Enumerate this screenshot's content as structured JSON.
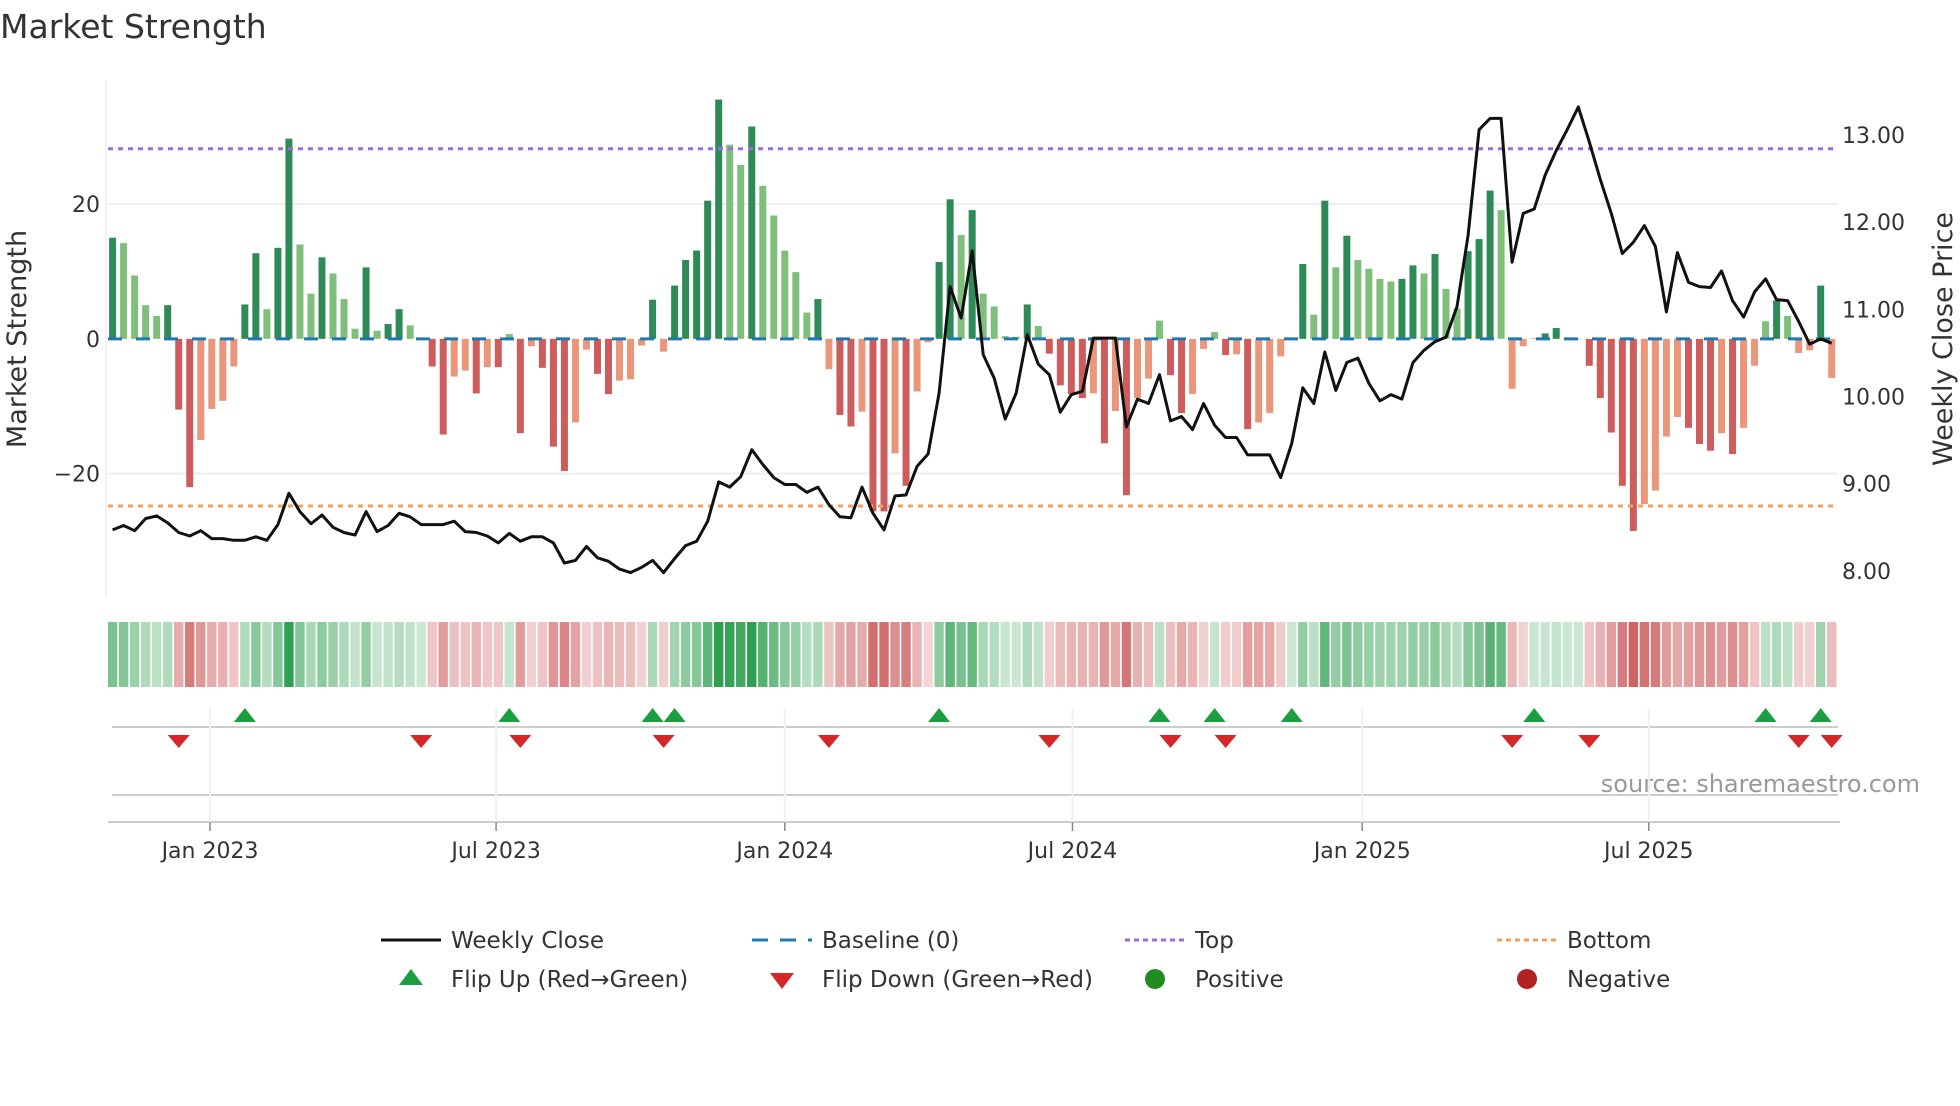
{
  "title": "Market Strength",
  "source": "source: sharemaestro.com",
  "colors": {
    "strong_pos": "#2e8b57",
    "weak_pos": "#7fbf7b",
    "strong_neg": "#cd5c5c",
    "weak_neg": "#e9967a",
    "price": "#111111",
    "baseline": "#1f77b4",
    "top": "#9b6be0",
    "bottom": "#f0a060",
    "flip_up": "#1a9e3f",
    "flip_down": "#d62728",
    "positive": "#228b22",
    "negative": "#b22222"
  },
  "chart_data": {
    "type": "bar",
    "title": "Market Strength",
    "ylabel": "Market Strength",
    "y2label": "Weekly Close Price",
    "ylim": [
      -38.3,
      38.4
    ],
    "y2lim": [
      7.7,
      13.63
    ],
    "yticks": [
      {
        "v": 20,
        "label": "20"
      },
      {
        "v": 0,
        "label": "0"
      },
      {
        "v": -20,
        "label": "−20"
      }
    ],
    "y2ticks": [
      {
        "v": 13,
        "label": "13.00"
      },
      {
        "v": 12,
        "label": "12.00"
      },
      {
        "v": 11,
        "label": "11.00"
      },
      {
        "v": 10,
        "label": "10.00"
      },
      {
        "v": 9,
        "label": "9.00"
      },
      {
        "v": 8,
        "label": "8.00"
      }
    ],
    "xticks": [
      {
        "i": 8.84,
        "label": "Jan 2023"
      },
      {
        "i": 34.8,
        "label": "Jul 2023"
      },
      {
        "i": 61.0,
        "label": "Jan 2024"
      },
      {
        "i": 87.1,
        "label": "Jul 2024"
      },
      {
        "i": 113.4,
        "label": "Jan 2025"
      },
      {
        "i": 139.4,
        "label": "Jul 2025"
      }
    ],
    "top": 28.2,
    "bottom": -24.8,
    "strength": [
      15.0,
      14.2,
      9.4,
      5.0,
      3.4,
      5.0,
      -10.5,
      -22.0,
      -15.0,
      -10.4,
      -9.2,
      -4.1,
      5.1,
      12.7,
      4.4,
      13.5,
      29.7,
      14.0,
      6.7,
      12.1,
      9.7,
      5.9,
      1.5,
      10.6,
      1.2,
      2.2,
      4.4,
      2.0,
      0,
      -4.1,
      -14.2,
      -5.6,
      -4.7,
      -8.1,
      -4.2,
      -4.2,
      0.7,
      -14.0,
      -1.1,
      -4.3,
      -16.0,
      -19.6,
      -12.4,
      -1.6,
      -5.2,
      -8.2,
      -6.2,
      -6.0,
      -1.0,
      5.8,
      -1.9,
      7.9,
      11.7,
      13.1,
      20.5,
      35.5,
      28.8,
      25.8,
      31.5,
      22.7,
      18.3,
      13.1,
      9.9,
      3.9,
      5.9,
      -4.5,
      -11.3,
      -13.0,
      -10.8,
      -25.6,
      -25.6,
      -17.0,
      -21.8,
      -7.8,
      -0.5,
      11.4,
      20.7,
      15.4,
      19.1,
      6.7,
      4.8,
      0.4,
      0.3,
      5.1,
      1.9,
      -2.2,
      -6.9,
      -8.2,
      -8.8,
      -8.1,
      -15.5,
      -10.7,
      -23.2,
      -8.8,
      -5.9,
      2.7,
      -5.4,
      -11.0,
      -8.2,
      -1.5,
      1.0,
      -2.4,
      -2.3,
      -13.4,
      -12.4,
      -11.0,
      -2.6,
      0.1,
      11.1,
      3.6,
      20.5,
      10.6,
      15.3,
      11.7,
      10.4,
      8.9,
      8.5,
      8.9,
      10.9,
      9.7,
      12.6,
      7.4,
      4.5,
      13.0,
      14.8,
      22.0,
      19.1,
      -7.4,
      -1.1,
      0.1,
      0.8,
      1.6,
      0.1,
      0,
      -4.0,
      -8.8,
      -13.9,
      -21.8,
      -28.5,
      -24.5,
      -22.5,
      -14.5,
      -11.6,
      -13.2,
      -15.6,
      -16.6,
      -14.0,
      -17.1,
      -13.2,
      -4.0,
      2.6,
      5.7,
      3.4,
      -2.1,
      -1.7,
      7.9,
      -5.8
    ],
    "weekly_close": [
      8.47,
      8.52,
      8.46,
      8.6,
      8.63,
      8.55,
      8.44,
      8.4,
      8.46,
      8.37,
      8.37,
      8.35,
      8.35,
      8.39,
      8.35,
      8.53,
      8.89,
      8.68,
      8.54,
      8.64,
      8.5,
      8.44,
      8.41,
      8.68,
      8.45,
      8.52,
      8.66,
      8.62,
      8.53,
      8.53,
      8.53,
      8.57,
      8.45,
      8.44,
      8.4,
      8.32,
      8.43,
      8.34,
      8.39,
      8.39,
      8.32,
      8.09,
      8.12,
      8.28,
      8.15,
      8.11,
      8.02,
      7.98,
      8.04,
      8.12,
      7.98,
      8.14,
      8.29,
      8.34,
      8.57,
      9.02,
      8.96,
      9.08,
      9.39,
      9.22,
      9.07,
      8.99,
      8.99,
      8.9,
      8.96,
      8.76,
      8.62,
      8.61,
      8.96,
      8.66,
      8.47,
      8.86,
      8.87,
      9.2,
      9.34,
      10.04,
      11.26,
      10.9,
      11.67,
      10.48,
      10.21,
      9.74,
      10.04,
      10.71,
      10.37,
      10.25,
      9.82,
      10.02,
      10.06,
      10.67,
      10.67,
      10.67,
      9.65,
      9.97,
      9.92,
      10.25,
      9.72,
      9.77,
      9.62,
      9.92,
      9.67,
      9.53,
      9.53,
      9.33,
      9.33,
      9.33,
      9.07,
      9.46,
      10.1,
      9.92,
      10.51,
      10.07,
      10.39,
      10.44,
      10.15,
      9.95,
      10.02,
      9.97,
      10.39,
      10.53,
      10.63,
      10.68,
      11.03,
      11.85,
      13.06,
      13.19,
      13.19,
      11.54,
      12.1,
      12.15,
      12.54,
      12.82,
      13.06,
      13.32,
      12.92,
      12.49,
      12.1,
      11.64,
      11.77,
      11.96,
      11.72,
      10.97,
      11.65,
      11.31,
      11.26,
      11.25,
      11.44,
      11.1,
      10.91,
      11.2,
      11.35,
      11.11,
      11.1,
      10.86,
      10.6,
      10.66,
      10.61
    ],
    "flip_up_weeks": [
      12,
      36,
      49,
      51,
      75,
      95,
      100,
      107,
      129,
      150,
      155
    ],
    "flip_down_weeks": [
      6,
      28,
      37,
      50,
      65,
      85,
      96,
      101,
      127,
      134,
      153,
      156
    ]
  },
  "legend": [
    {
      "key": "line",
      "label": "Weekly Close"
    },
    {
      "key": "baseline",
      "label": "Baseline (0)"
    },
    {
      "key": "top",
      "label": "Top"
    },
    {
      "key": "bottom",
      "label": "Bottom"
    },
    {
      "key": "up",
      "label": "Flip Up (Red→Green)"
    },
    {
      "key": "down",
      "label": "Flip Down (Green→Red)"
    },
    {
      "key": "pos",
      "label": "Positive"
    },
    {
      "key": "neg",
      "label": "Negative"
    }
  ]
}
